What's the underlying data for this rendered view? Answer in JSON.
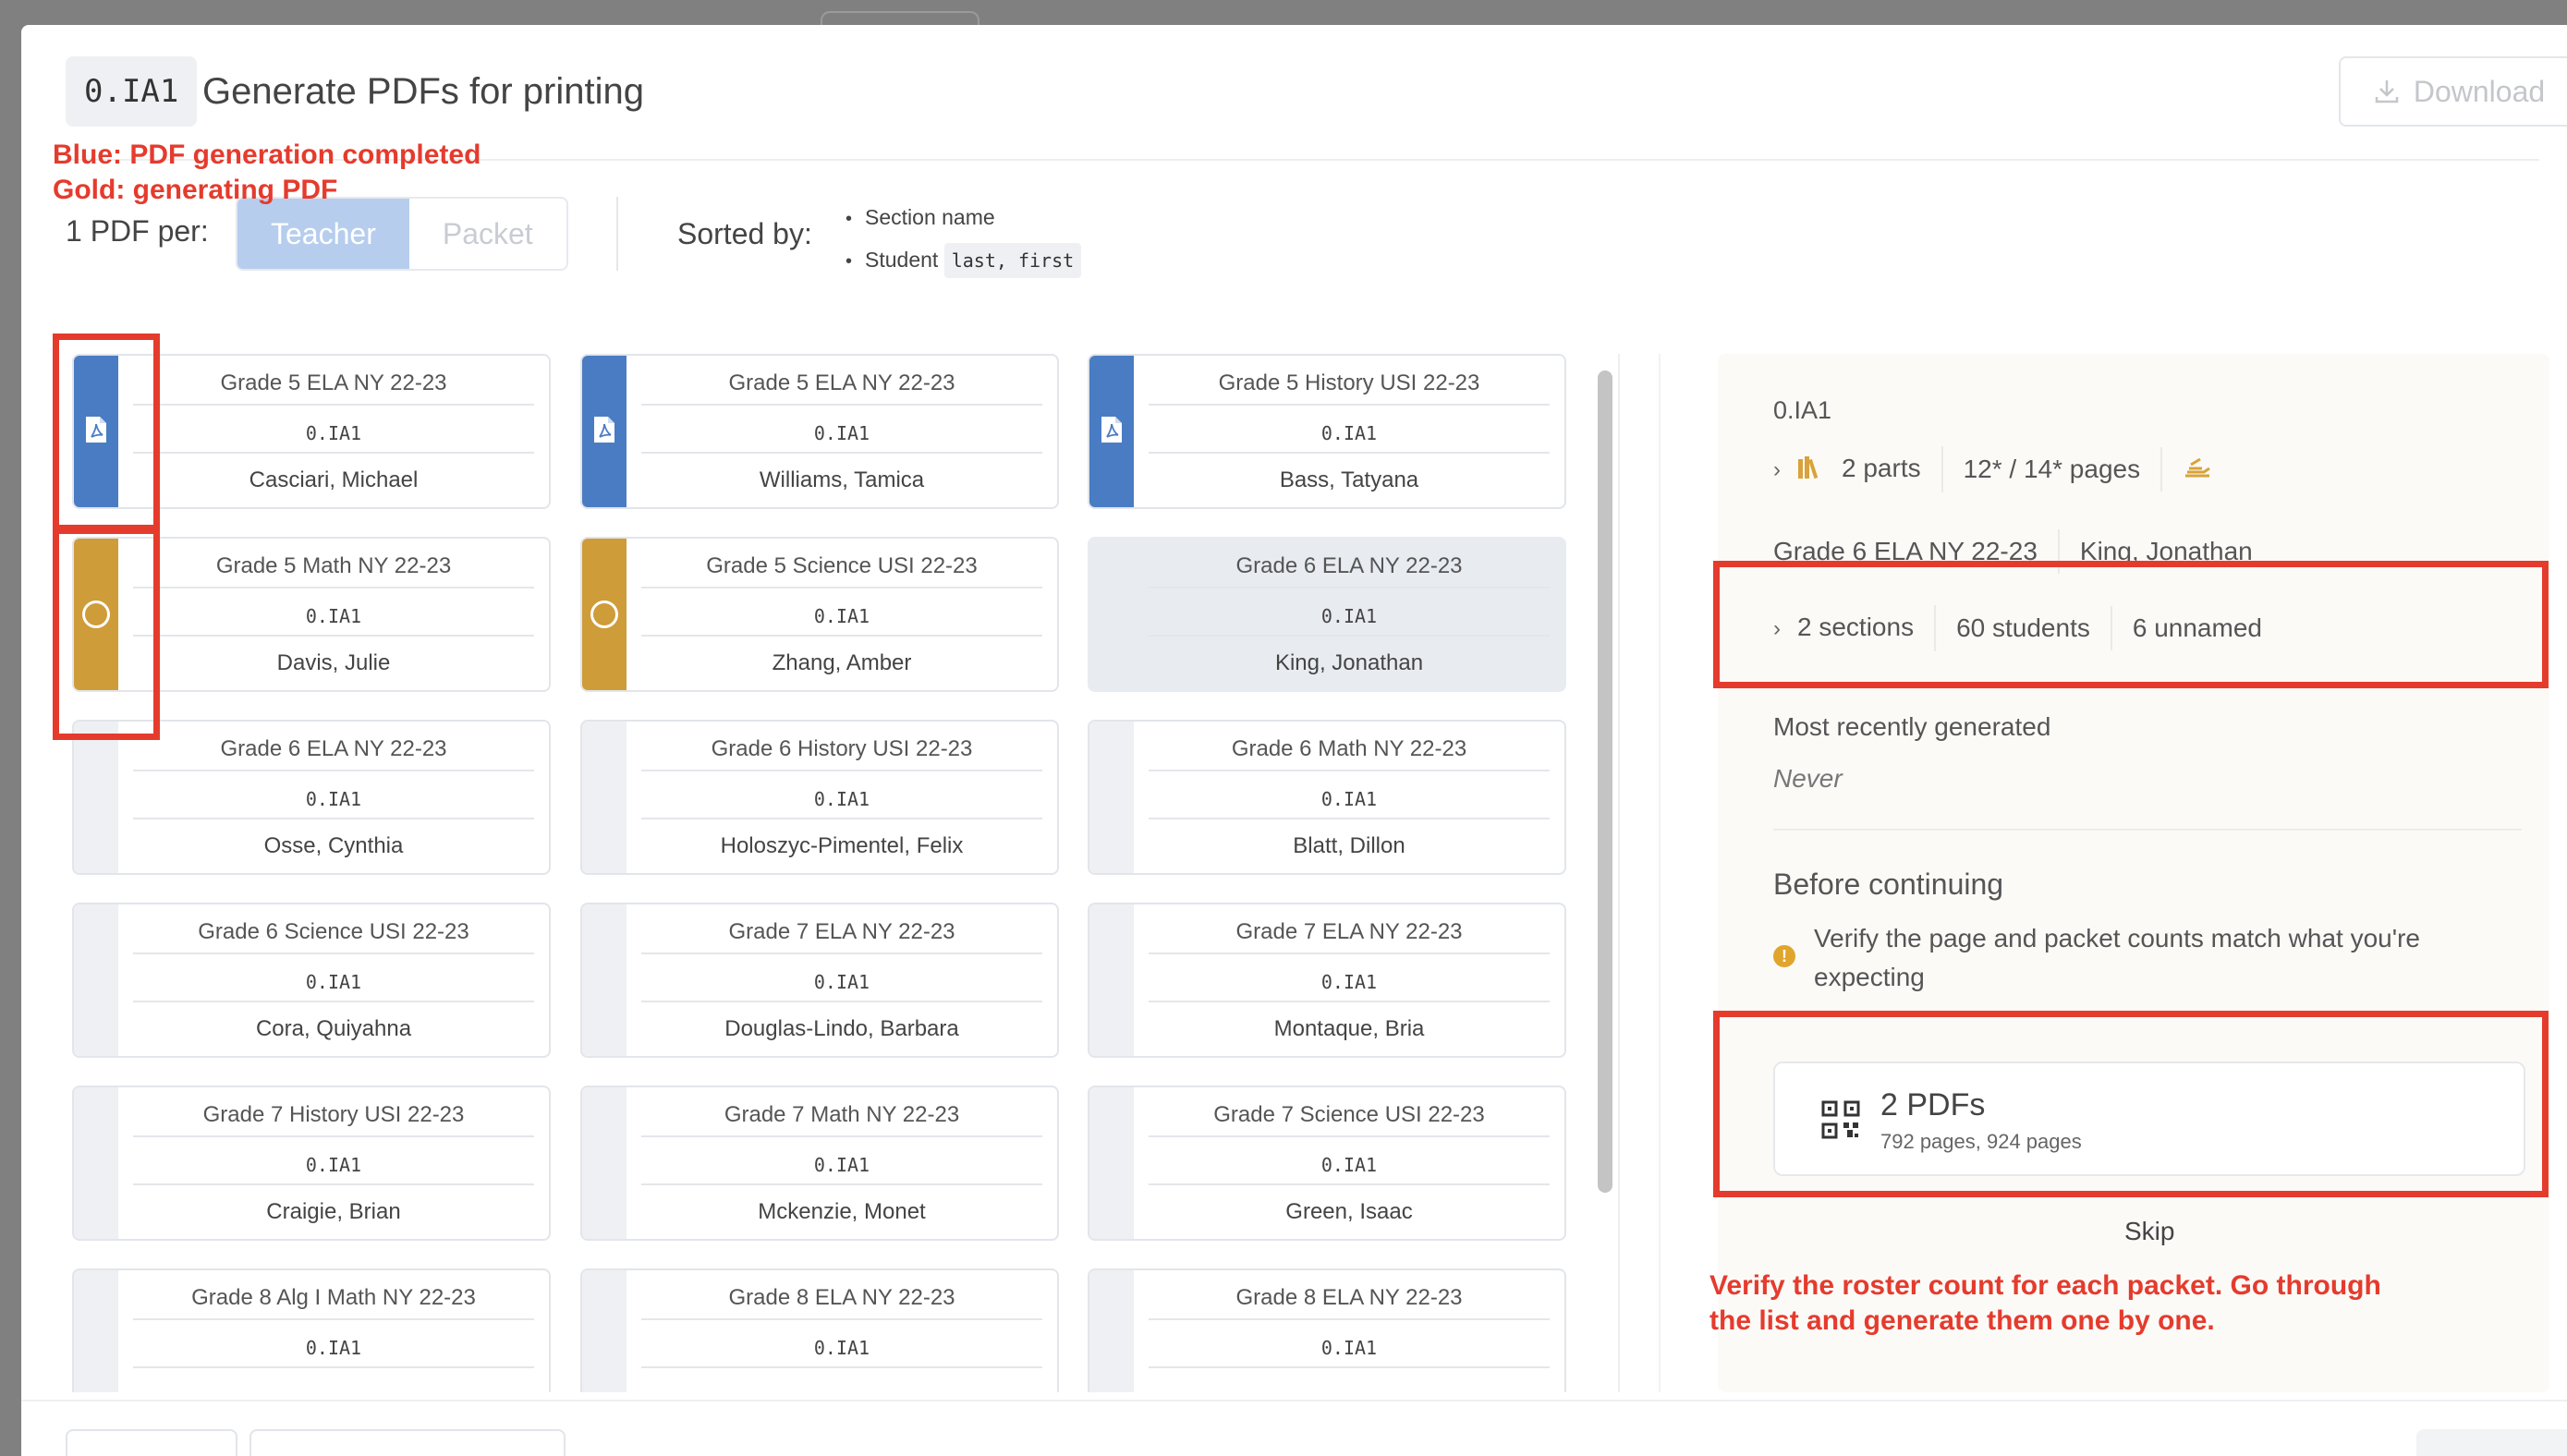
{
  "header": {
    "code": "0.IA1",
    "title": "Generate PDFs for printing",
    "download_label": "Download"
  },
  "controls": {
    "per_label": "1 PDF per:",
    "options": [
      "Teacher",
      "Packet"
    ],
    "selected": "Teacher",
    "sorted_label": "Sorted by:",
    "sort_items": [
      {
        "text": "Section name",
        "code": ""
      },
      {
        "text": "Student",
        "code": "last, first"
      }
    ]
  },
  "annotations": {
    "legend_blue": "Blue: PDF generation completed",
    "legend_gold": "Gold: generating PDF",
    "bottom_note_1": "Verify the roster count for each packet. Go through",
    "bottom_note_2": "the list and generate them one by one."
  },
  "colors": {
    "blue_status": "#4a7cc4",
    "gold_status": "#cf9c3a",
    "annotation_red": "#e53b2d"
  },
  "cards": [
    {
      "course": "Grade 5 ELA NY 22-23",
      "code": "0.IA1",
      "teacher": "Casciari, Michael",
      "status": "blue"
    },
    {
      "course": "Grade 5 ELA NY 22-23",
      "code": "0.IA1",
      "teacher": "Williams, Tamica",
      "status": "blue"
    },
    {
      "course": "Grade 5 History USI 22-23",
      "code": "0.IA1",
      "teacher": "Bass, Tatyana",
      "status": "blue"
    },
    {
      "course": "Grade 5 Math NY 22-23",
      "code": "0.IA1",
      "teacher": "Davis, Julie",
      "status": "gold"
    },
    {
      "course": "Grade 5 Science USI 22-23",
      "code": "0.IA1",
      "teacher": "Zhang, Amber",
      "status": "gold"
    },
    {
      "course": "Grade 6 ELA NY 22-23",
      "code": "0.IA1",
      "teacher": "King, Jonathan",
      "status": "selected"
    },
    {
      "course": "Grade 6 ELA NY 22-23",
      "code": "0.IA1",
      "teacher": "Osse, Cynthia",
      "status": "none"
    },
    {
      "course": "Grade 6 History USI 22-23",
      "code": "0.IA1",
      "teacher": "Holoszyc-Pimentel, Felix",
      "status": "none"
    },
    {
      "course": "Grade 6 Math NY 22-23",
      "code": "0.IA1",
      "teacher": "Blatt, Dillon",
      "status": "none"
    },
    {
      "course": "Grade 6 Science USI 22-23",
      "code": "0.IA1",
      "teacher": "Cora, Quiyahna",
      "status": "none"
    },
    {
      "course": "Grade 7 ELA NY 22-23",
      "code": "0.IA1",
      "teacher": "Douglas-Lindo, Barbara",
      "status": "none"
    },
    {
      "course": "Grade 7 ELA NY 22-23",
      "code": "0.IA1",
      "teacher": "Montaque, Bria",
      "status": "none"
    },
    {
      "course": "Grade 7 History USI 22-23",
      "code": "0.IA1",
      "teacher": "Craigie, Brian",
      "status": "none"
    },
    {
      "course": "Grade 7 Math NY 22-23",
      "code": "0.IA1",
      "teacher": "Mckenzie, Monet",
      "status": "none"
    },
    {
      "course": "Grade 7 Science USI 22-23",
      "code": "0.IA1",
      "teacher": "Green, Isaac",
      "status": "none"
    },
    {
      "course": "Grade 8 Alg I Math NY 22-23",
      "code": "0.IA1",
      "teacher": "",
      "status": "none"
    },
    {
      "course": "Grade 8 ELA NY 22-23",
      "code": "0.IA1",
      "teacher": "",
      "status": "none"
    },
    {
      "course": "Grade 8 ELA NY 22-23",
      "code": "0.IA1",
      "teacher": "",
      "status": "none"
    }
  ],
  "panel": {
    "code": "0.IA1",
    "parts": "2 parts",
    "pages": "12* / 14* pages",
    "course": "Grade 6 ELA NY 22-23",
    "teacher": "King, Jonathan",
    "sections": "2 sections",
    "students": "60 students",
    "unnamed": "6 unnamed",
    "recent_label": "Most recently generated",
    "recent_value": "Never",
    "before_heading": "Before continuing",
    "verify_text": "Verify the page and packet counts match what you're expecting",
    "pdf_title": "2 PDFs",
    "pdf_sub": "792 pages, 924 pages",
    "skip_label": "Skip"
  },
  "icons": {
    "download": "download-icon",
    "pdf": "pdf-file-icon",
    "pending": "circle-icon",
    "books": "books-icon",
    "hand": "hand-icon",
    "warning": "warning-icon",
    "qr": "qr-code-icon"
  }
}
